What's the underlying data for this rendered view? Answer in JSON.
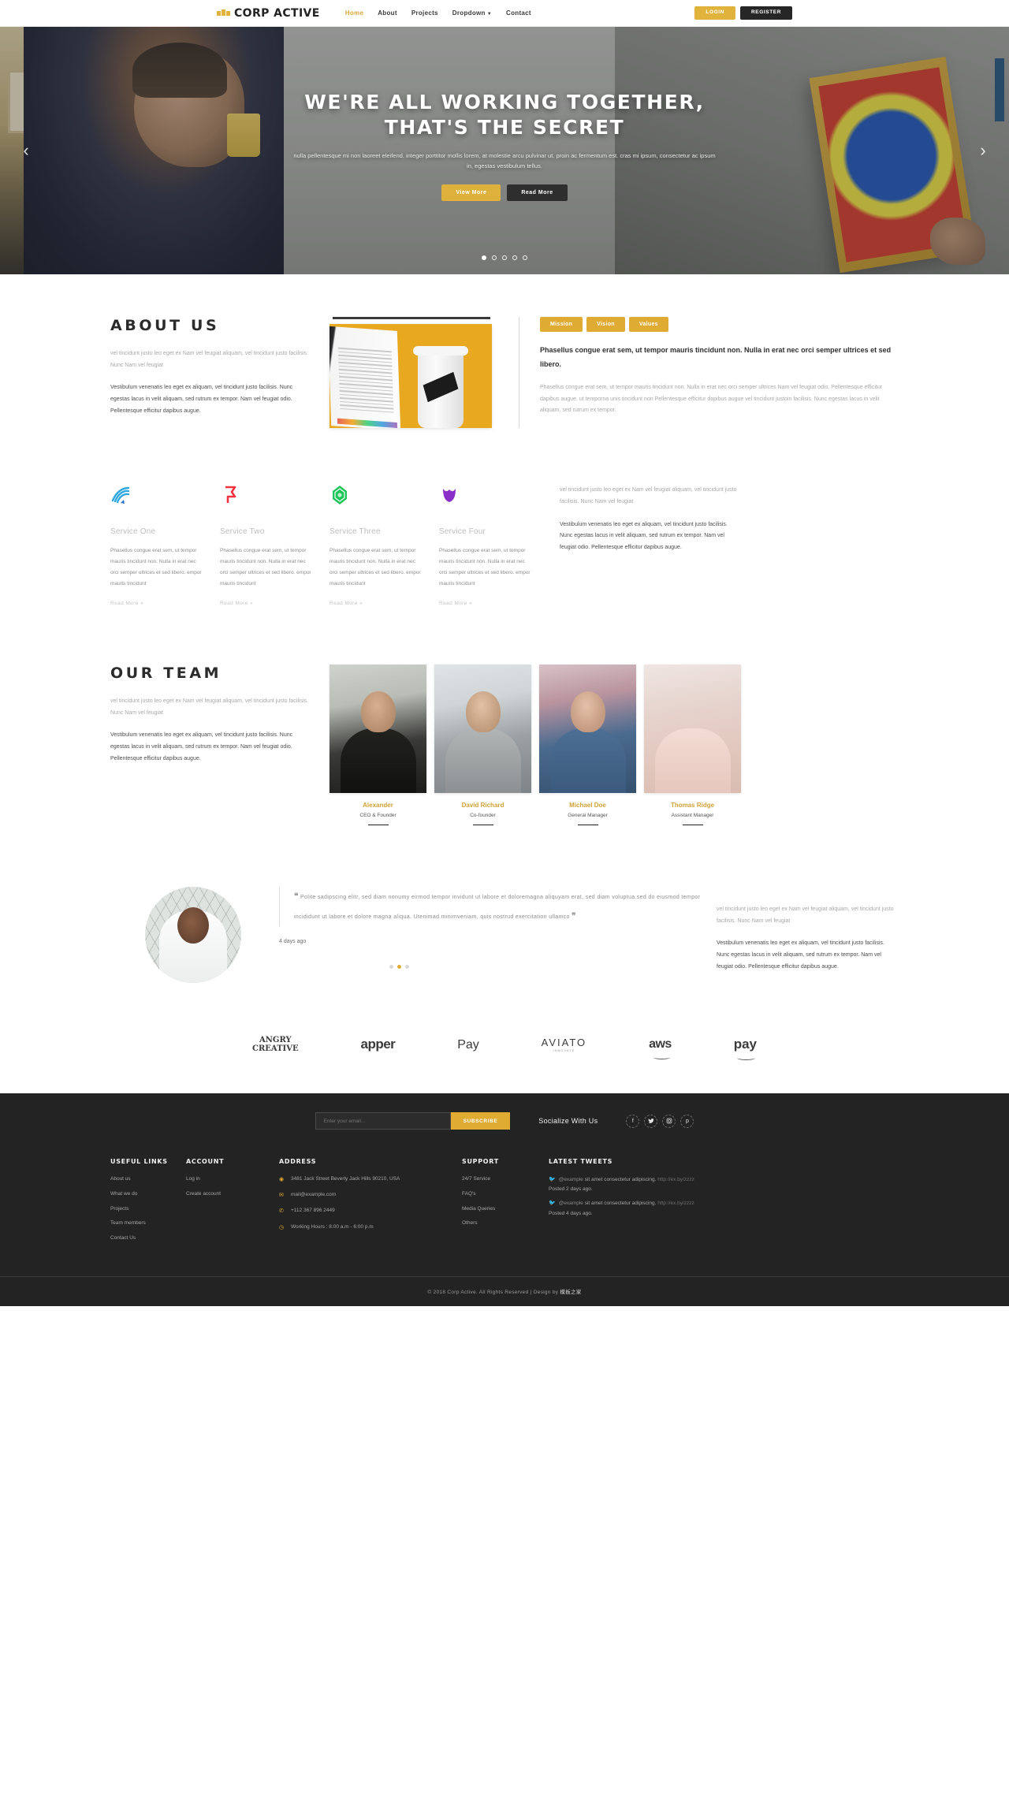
{
  "brand": {
    "name": "CORP ACTIVE",
    "logo_icon": "boxes-logo-icon"
  },
  "accent": "#e0ab33",
  "nav": {
    "items": [
      {
        "label": "Home",
        "active": true
      },
      {
        "label": "About",
        "active": false
      },
      {
        "label": "Projects",
        "active": false
      },
      {
        "label": "Dropdown",
        "active": false,
        "caret": "▼"
      },
      {
        "label": "Contact",
        "active": false
      }
    ],
    "login_label": "LOGIN",
    "register_label": "REGISTER"
  },
  "hero": {
    "title_line1": "WE'RE ALL WORKING TOGETHER,",
    "title_line2": "THAT'S THE SECRET",
    "subtitle": "nulla pellentesque mi non laoreet eleifend. integer porttitor mollis lorem, at molestie arcu pulvinar ut. proin ac fermentum est. cras mi ipsum, consectetur ac ipsum in, egestas vestibulum tellus.",
    "btn_view": "View More",
    "btn_read": "Read More",
    "arrow_prev": "‹",
    "arrow_next": "›",
    "dots": [
      true,
      false,
      false,
      false,
      false
    ]
  },
  "about": {
    "title": "ABOUT US",
    "p1": "vel tincidunt justo leo eget ex Nam vel feugiat aliquam, vel tincidunt justo facilisis. Nunc Nam vel feugiat",
    "p2": "Vestibulum venenatis leo eget ex aliquam, vel tincidunt justo facilisis. Nunc egestas lacus in velit aliquam, sed rutrum ex tempor. Nam vel feugiat odio. Pellentesque efficitur dapibus augue.",
    "tabs": [
      "Mission",
      "Vision",
      "Values"
    ],
    "lead": "Phasellus congue erat sem, ut tempor mauris tincidunt non. Nulla in erat nec orci semper ultrices et sed libero.",
    "body": "Phasellus congue erat sem, ut tempor mauris tincidunt non. Nulla in erat nec orci semper ultrices Nam vel feugiat odio. Pellentesque efficitur dapibus augue. ut temporna unis tincidunt non Pellentesque efficitur dapibus augue vel tincidunt justoin facilisis. Nunc egestas lacus in velit aliquam, sed rutrum ex tempor."
  },
  "services": {
    "items": [
      {
        "title": "Service One",
        "icon": "wave-lines-icon",
        "color": "#2fa8e0",
        "body": "Phasellus congue erat sem, ut tempor mauris tincidunt non. Nulla in erat nec orci semper ultrices et sed libero. empor mauris tincidunt",
        "more": "Read More »"
      },
      {
        "title": "Service Two",
        "icon": "flag-icon",
        "color": "#f5333f",
        "body": "Phasellus congue erat sem, ut tempor mauris tincidunt non. Nulla in erat nec orci semper ultrices et sed libero. empor mauris tincidunt",
        "more": "Read More »"
      },
      {
        "title": "Service Three",
        "icon": "gem-icon",
        "color": "#1fc65a",
        "body": "Phasellus congue erat sem, ut tempor mauris tincidunt non. Nulla in erat nec orci semper ultrices et sed libero. empor mauris tincidunt",
        "more": "Read More »"
      },
      {
        "title": "Service Four",
        "icon": "tulip-icon",
        "color": "#8b2fc9",
        "body": "Phasellus congue erat sem, ut tempor mauris tincidunt non. Nulla in erat nec orci semper ultrices et sed libero. empor mauris tincidunt",
        "more": "Read More »"
      }
    ],
    "aside_p1": "vel tincidunt justo leo eget ex Nam vel feugiat aliquam, vel tincidunt justo facilisis. Nunc Nam vel feugiat",
    "aside_p2": "Vestibulum venenatis leo eget ex aliquam, vel tincidunt justo facilisis. Nunc egestas lacus in velit aliquam, sed rutrum ex tempor. Nam vel feugiat odio. Pellentesque efficitur dapibus augue."
  },
  "team": {
    "title": "OUR TEAM",
    "p1": "vel tincidunt justo leo eget ex Nam vel feugiat aliquam, vel tincidunt justo facilisis. Nunc Nam vel feugiat",
    "p2": "Vestibulum venenatis leo eget ex aliquam, vel tincidunt justo facilisis. Nunc egestas lacus in velit aliquam, sed rutrum ex tempor. Nam vel feugiat odio. Pellentesque efficitur dapibus augue.",
    "members": [
      {
        "name": "Alexander",
        "role": "CEO & Founder"
      },
      {
        "name": "David Richard",
        "role": "Co-founder"
      },
      {
        "name": "Michael Doe",
        "role": "General Manager"
      },
      {
        "name": "Thomas Ridge",
        "role": "Assistant Manager"
      }
    ]
  },
  "testimonial": {
    "quote_open": "❝",
    "quote_close": "❞",
    "text": "Polite sadipscing elitr, sed diam nonumy eirmod tempor invidunt ut labore et doloremagna aliquyam erat, sed diam voluptua.sed do eiusmod tempor incididunt ut labore et dolore magna aliqua. Utenimad minimveniam, quis nostrud exercitation ullamco",
    "ago": "4 days ago",
    "dots": [
      false,
      true,
      false
    ],
    "aside_p1": "vel tincidunt justo leo eget ex Nam vel feugiat aliquam, vel tincidunt justo facilisis. Nunc Nam vel feugiat",
    "aside_p2": "Vestibulum venenatis leo eget ex aliquam, vel tincidunt justo facilisis. Nunc egestas lacus in velit aliquam, sed rutrum ex tempor. Nam vel feugiat odio. Pellentesque efficitur dapibus augue."
  },
  "brands": [
    {
      "name": "ANGRY CREATIVE",
      "line1": "ANGRY",
      "line2": "CREATIVE"
    },
    {
      "name": "apper",
      "text": "apper"
    },
    {
      "name": "Apple Pay",
      "text": "Pay",
      "glyph": ""
    },
    {
      "name": "AVIATO",
      "text": "AVIATO",
      "sub": "INNOVATE"
    },
    {
      "name": "aws",
      "text": "aws"
    },
    {
      "name": "amazon pay",
      "text": "pay"
    }
  ],
  "footer": {
    "subscribe_placeholder": "Enter your email...",
    "subscribe_label": "SUBSCRIBE",
    "social_label": "Socialize With Us",
    "social": [
      {
        "name": "facebook-icon",
        "glyph": "f"
      },
      {
        "name": "twitter-icon",
        "glyph": "🐦"
      },
      {
        "name": "instagram-icon",
        "glyph": "◉"
      },
      {
        "name": "pinterest-icon",
        "glyph": "p"
      }
    ],
    "useful_links": {
      "title": "USEFUL LINKS",
      "items": [
        "About us",
        "What we do",
        "Projects",
        "Team members",
        "Contact Us"
      ]
    },
    "account": {
      "title": "ACCOUNT",
      "items": [
        "Log in",
        "Create account"
      ]
    },
    "address": {
      "title": "ADDRESS",
      "items": [
        {
          "icon": "location-pin-icon",
          "glyph": "◉",
          "text": "3481 Jack Street Beverly Jack Hills 90210, USA"
        },
        {
          "icon": "envelope-icon",
          "glyph": "✉",
          "text": "mail@example.com"
        },
        {
          "icon": "phone-icon",
          "glyph": "✆",
          "text": "+112 367 896 2449"
        },
        {
          "icon": "clock-icon",
          "glyph": "◷",
          "text": "Working Hours : 8:00 a.m - 6:00 p.m"
        }
      ]
    },
    "support": {
      "title": "SUPPORT",
      "items": [
        "24/7 Service",
        "FAQ's",
        "Media Queries",
        "Others"
      ]
    },
    "tweets": {
      "title": "LATEST TWEETS",
      "items": [
        {
          "handle": "@example",
          "text": "sit amet consectetur adipiscing.",
          "link": "http://ex.by/zzzz",
          "posted": "Posted 2 days ago."
        },
        {
          "handle": "@example",
          "text": "sit amet consectetur adipiscing.",
          "link": "http://ex.by/zzzz",
          "posted": "Posted 4 days ago."
        }
      ]
    },
    "copyright_prefix": "© 2018 Corp Active. All Rights Reserved | Design by ",
    "copyright_designer": "模板之家"
  }
}
